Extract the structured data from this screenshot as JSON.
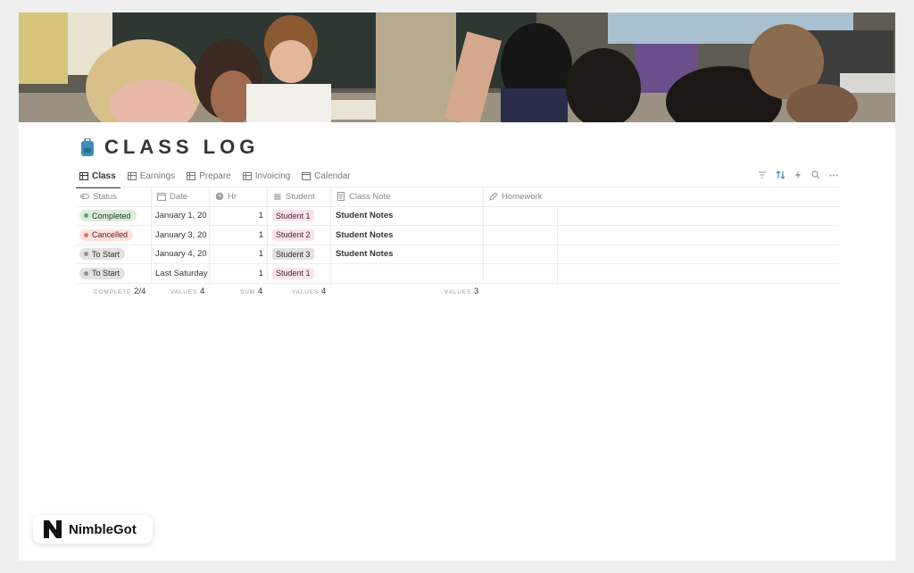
{
  "page": {
    "title": "CLASS LOG",
    "title_icon": "backpack-icon"
  },
  "tabs": [
    {
      "label": "Class",
      "icon": "table-icon",
      "active": true
    },
    {
      "label": "Earnings",
      "icon": "table-icon",
      "active": false
    },
    {
      "label": "Prepare",
      "icon": "table-icon",
      "active": false
    },
    {
      "label": "Invoicing",
      "icon": "table-icon",
      "active": false
    },
    {
      "label": "Calendar",
      "icon": "calendar-icon",
      "active": false
    }
  ],
  "toolbar": [
    "filter-icon",
    "sort-icon",
    "lightning-icon",
    "search-icon",
    "more-icon"
  ],
  "columns": {
    "status": "Status",
    "date": "Date",
    "hr": "Hr",
    "student": "Student",
    "note": "Class Note",
    "homework": "Homework"
  },
  "rows": [
    {
      "status": "Completed",
      "date": "January 1, 20",
      "hr": "1",
      "student": "Student 1",
      "note": "Student Notes",
      "homework": ""
    },
    {
      "status": "Cancelled",
      "date": "January 3, 20",
      "hr": "1",
      "student": "Student 2",
      "note": "Student Notes",
      "homework": ""
    },
    {
      "status": "To Start",
      "date": "January 4, 20",
      "hr": "1",
      "student": "Student 3",
      "note": "Student Notes",
      "homework": ""
    },
    {
      "status": "To Start",
      "date": "Last Saturday",
      "hr": "1",
      "student": "Student 1",
      "note": "",
      "homework": ""
    }
  ],
  "aggregates": {
    "status": {
      "label": "COMPLETE",
      "value": "2/4"
    },
    "date": {
      "label": "VALUES",
      "value": "4"
    },
    "hr": {
      "label": "SUM",
      "value": "4"
    },
    "student": {
      "label": "VALUES",
      "value": "4"
    },
    "note": {
      "label": "VALUES",
      "value": "3"
    }
  },
  "colors": {
    "completed_bg": "#dbeddb",
    "completed_dot": "#6c9b7d",
    "cancelled_bg": "#ffe2dd",
    "cancelled_dot": "#e16f64",
    "tostart_bg": "#e3e2e0",
    "tostart_dot": "#91918e",
    "student1_bg": "#f9e4ec",
    "student2_bg": "#f9e4ec",
    "student3_bg": "#e3e2e0",
    "title_icon": "#3a8fb7"
  },
  "brand": {
    "name": "NimbleGot",
    "icon": "nimblegot-logo"
  }
}
